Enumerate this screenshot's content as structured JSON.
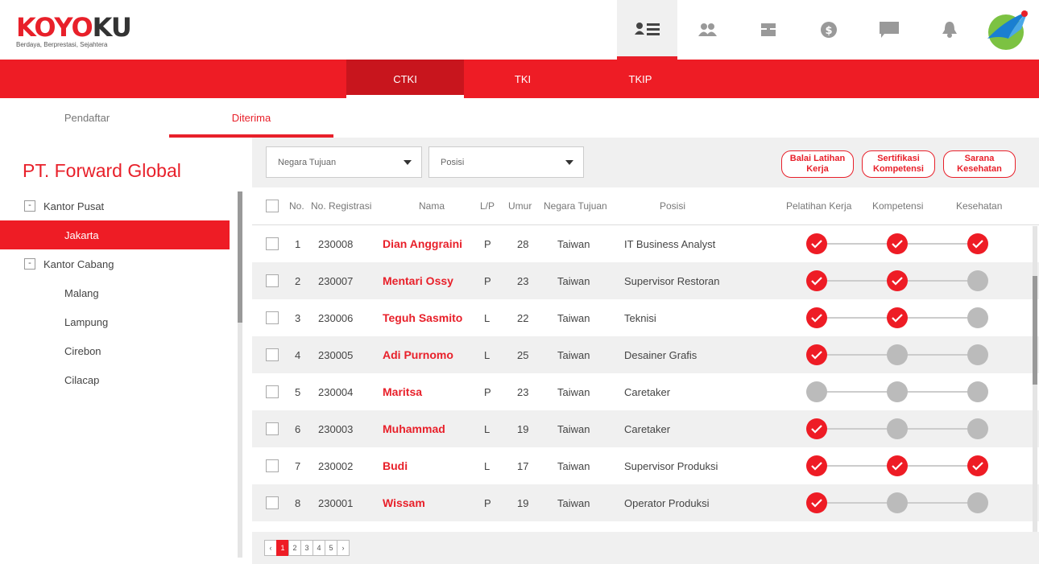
{
  "logo": {
    "red_part": "KOYO",
    "dark_part": "KU",
    "tagline": "Berdaya, Berprestasi, Sejahtera"
  },
  "nav_icons": [
    "list-user-icon",
    "users-icon",
    "card-icon",
    "dollar-icon",
    "chat-icon",
    "bell-icon"
  ],
  "main_tabs": [
    {
      "label": "CTKI",
      "active": true
    },
    {
      "label": "TKI",
      "active": false
    },
    {
      "label": "TKIP",
      "active": false
    }
  ],
  "sub_tabs": [
    {
      "label": "Pendaftar",
      "active": false
    },
    {
      "label": "Diterima",
      "active": true
    }
  ],
  "company": "PT. Forward Global",
  "tree": {
    "pusat": {
      "toggle": "-",
      "label": "Kantor Pusat"
    },
    "pusat_items": [
      "Jakarta"
    ],
    "cabang": {
      "toggle": "-",
      "label": "Kantor Cabang"
    },
    "cabang_items": [
      "Malang",
      "Lampung",
      "Cirebon",
      "Cilacap"
    ]
  },
  "filters": {
    "negara": "Negara Tujuan",
    "posisi": "Posisi"
  },
  "pills": [
    {
      "line1": "Balai Latihan",
      "line2": "Kerja"
    },
    {
      "line1": "Sertifikasi",
      "line2": "Kompetensi"
    },
    {
      "line1": "Sarana",
      "line2": "Kesehatan"
    }
  ],
  "columns": {
    "no": "No.",
    "reg": "No. Registrasi",
    "nama": "Nama",
    "lp": "L/P",
    "umur": "Umur",
    "negara": "Negara Tujuan",
    "posisi": "Posisi",
    "pelatihan": "Pelatihan Kerja",
    "kompetensi": "Kompetensi",
    "kesehatan": "Kesehatan"
  },
  "rows": [
    {
      "no": "1",
      "reg": "230008",
      "nama": "Dian Anggraini",
      "lp": "P",
      "umur": "28",
      "negara": "Taiwan",
      "posisi": "IT Business Analyst",
      "status": [
        true,
        true,
        true
      ]
    },
    {
      "no": "2",
      "reg": "230007",
      "nama": "Mentari Ossy",
      "lp": "P",
      "umur": "23",
      "negara": "Taiwan",
      "posisi": "Supervisor Restoran",
      "status": [
        true,
        true,
        false
      ]
    },
    {
      "no": "3",
      "reg": "230006",
      "nama": "Teguh Sasmito",
      "lp": "L",
      "umur": "22",
      "negara": "Taiwan",
      "posisi": "Teknisi",
      "status": [
        true,
        true,
        false
      ]
    },
    {
      "no": "4",
      "reg": "230005",
      "nama": "Adi Purnomo",
      "lp": "L",
      "umur": "25",
      "negara": "Taiwan",
      "posisi": "Desainer Grafis",
      "status": [
        true,
        false,
        false
      ]
    },
    {
      "no": "5",
      "reg": "230004",
      "nama": "Maritsa",
      "lp": "P",
      "umur": "23",
      "negara": "Taiwan",
      "posisi": "Caretaker",
      "status": [
        false,
        false,
        false
      ]
    },
    {
      "no": "6",
      "reg": "230003",
      "nama": "Muhammad",
      "lp": "L",
      "umur": "19",
      "negara": "Taiwan",
      "posisi": "Caretaker",
      "status": [
        true,
        false,
        false
      ]
    },
    {
      "no": "7",
      "reg": "230002",
      "nama": "Budi",
      "lp": "L",
      "umur": "17",
      "negara": "Taiwan",
      "posisi": "Supervisor Produksi",
      "status": [
        true,
        true,
        true
      ]
    },
    {
      "no": "8",
      "reg": "230001",
      "nama": "Wissam",
      "lp": "P",
      "umur": "19",
      "negara": "Taiwan",
      "posisi": "Operator Produksi",
      "status": [
        true,
        false,
        false
      ]
    }
  ],
  "pagination": {
    "prev": "‹",
    "pages": [
      "1",
      "2",
      "3",
      "4",
      "5"
    ],
    "current": "1",
    "next": "›"
  },
  "colors": {
    "accent": "#ee1c25",
    "inactive_dot": "#bbbbbb"
  }
}
